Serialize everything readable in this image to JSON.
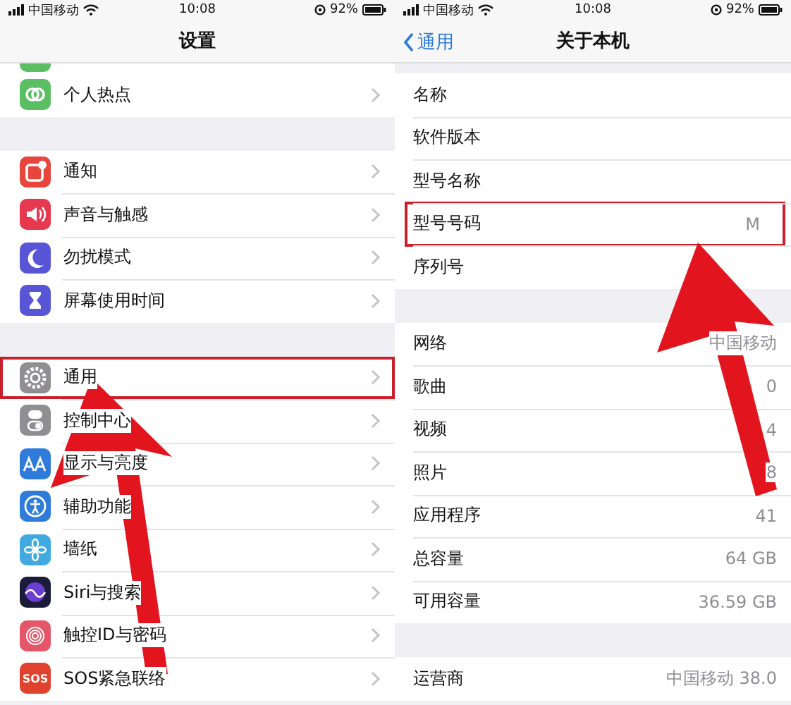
{
  "screens": [
    {
      "status_bar": {
        "carrier": "中国移动",
        "time": "10:08",
        "battery": "92%"
      },
      "title": "设置",
      "groups": [
        {
          "items": [
            {
              "label": "个人热点",
              "kind": "hotspot",
              "highlighted": false
            }
          ]
        },
        {
          "items": [
            {
              "label": "通知",
              "kind": "notifications",
              "highlighted": false
            },
            {
              "label": "声音与触感",
              "kind": "sound",
              "highlighted": false
            },
            {
              "label": "勿扰模式",
              "kind": "moon",
              "highlighted": false
            },
            {
              "label": "屏幕使用时间",
              "kind": "hourglass",
              "highlighted": false
            }
          ]
        },
        {
          "items": [
            {
              "label": "通用",
              "kind": "gear",
              "highlighted": true
            },
            {
              "label": "控制中心",
              "kind": "toggles",
              "highlighted": false
            },
            {
              "label": "显示与亮度",
              "kind": "text-size",
              "highlighted": false
            },
            {
              "label": "辅助功能",
              "kind": "accessibility",
              "highlighted": false
            },
            {
              "label": "墙纸",
              "kind": "flower",
              "highlighted": false
            },
            {
              "label": "Siri与搜索",
              "kind": "siri",
              "highlighted": false
            },
            {
              "label": "触控ID与密码",
              "kind": "fingerprint",
              "highlighted": false
            },
            {
              "label": "SOS紧急联络",
              "kind": "sos",
              "badge": "SOS",
              "highlighted": false
            }
          ]
        }
      ]
    },
    {
      "status_bar": {
        "carrier": "中国移动",
        "time": "10:08",
        "battery": "92%"
      },
      "title": "关于本机",
      "back": "通用",
      "groups": [
        {
          "items": [
            {
              "label": "名称",
              "highlighted": false
            },
            {
              "label": "软件版本",
              "highlighted": false
            },
            {
              "label": "型号名称",
              "highlighted": false
            },
            {
              "label": "型号号码",
              "value": "M",
              "highlighted": true
            },
            {
              "label": "序列号",
              "highlighted": false
            }
          ]
        },
        {
          "items": [
            {
              "label": "网络",
              "value": "中国移动",
              "highlighted": false
            },
            {
              "label": "歌曲",
              "value": "0",
              "highlighted": false
            },
            {
              "label": "视频",
              "value": "4",
              "highlighted": false
            },
            {
              "label": "照片",
              "value": "8",
              "highlighted": false
            },
            {
              "label": "应用程序",
              "value": "41",
              "highlighted": false
            },
            {
              "label": "总容量",
              "value": "64 GB",
              "highlighted": false
            },
            {
              "label": "可用容量",
              "value": "36.59 GB",
              "highlighted": false
            }
          ]
        },
        {
          "items": [
            {
              "label": "运营商",
              "value": "中国移动 38.0",
              "highlighted": false
            }
          ]
        }
      ]
    }
  ]
}
